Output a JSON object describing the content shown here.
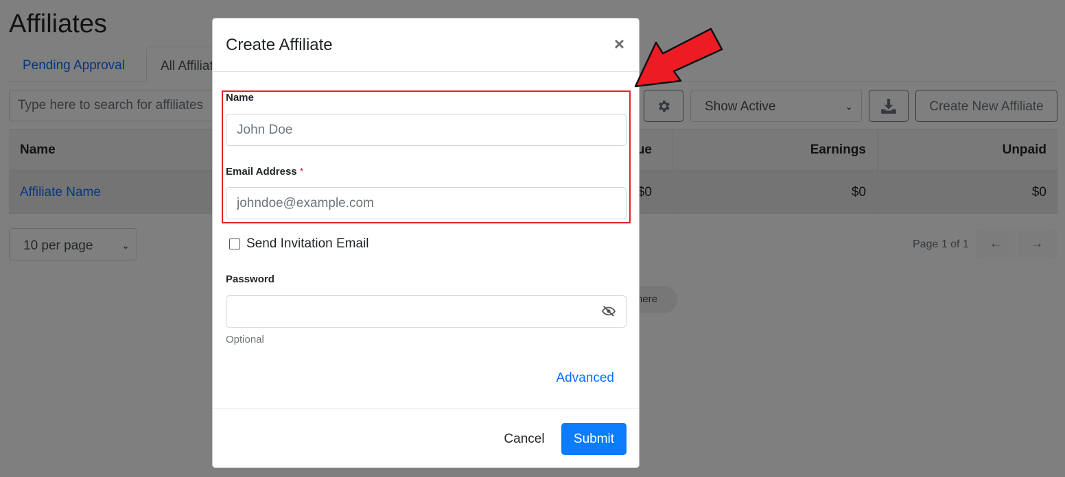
{
  "page": {
    "title": "Affiliates"
  },
  "tabs": [
    {
      "label": "Pending Approval"
    },
    {
      "label": "All Affiliates"
    }
  ],
  "toolbar": {
    "search_placeholder": "Type here to search for affiliates",
    "status_filter_value": "Show Active",
    "create_button_label": "Create New Affiliate"
  },
  "table": {
    "columns": [
      "Name",
      "Revenue",
      "Earnings",
      "Unpaid"
    ],
    "rows": [
      {
        "name": "Affiliate Name",
        "revenue": "$0",
        "earnings": "$0",
        "unpaid": "$0"
      }
    ]
  },
  "pagination": {
    "per_page_value": "10 per page",
    "page_info": "Page 1 of 1"
  },
  "hint_pill": {
    "text": "here"
  },
  "modal": {
    "title": "Create Affiliate",
    "name_label": "Name",
    "name_placeholder": "John Doe",
    "email_label": "Email Address",
    "email_required_marker": "*",
    "email_placeholder": "johndoe@example.com",
    "invite_label": "Send Invitation Email",
    "password_label": "Password",
    "password_help": "Optional",
    "advanced_label": "Advanced",
    "cancel_label": "Cancel",
    "submit_label": "Submit"
  },
  "colors": {
    "accent": "#0b7cff",
    "link": "#0d6efd",
    "annotation_red": "#e3222a"
  }
}
